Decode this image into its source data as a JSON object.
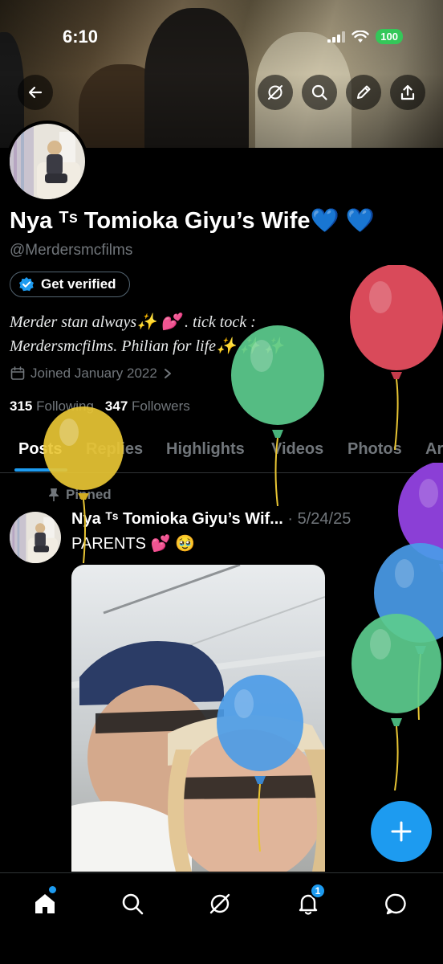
{
  "status_bar": {
    "time": "6:10",
    "battery": "100"
  },
  "header": {
    "back_icon": "arrow-left-icon",
    "grok_icon": "grok-icon",
    "search_icon": "search-icon",
    "edit_icon": "pencil-icon",
    "share_icon": "share-icon"
  },
  "profile": {
    "display_name": "Nya ᵀˢ Tomioka Giyu’s Wife💙 💙",
    "handle": "@Merdersmcfilms",
    "verify_label": "Get verified",
    "bio_line1": "Merder stan always✨ 💕 .   tick tock :",
    "bio_line2": "Merdersmcfilms.   Philian for life✨ ✨ ✨",
    "joined": "Joined January 2022",
    "following_count": "315",
    "following_label": "Following",
    "followers_count": "347",
    "followers_label": "Followers"
  },
  "tabs": [
    "Posts",
    "Replies",
    "Highlights",
    "Videos",
    "Photos",
    "Ar"
  ],
  "post": {
    "pinned_label": "Pinned",
    "author": "Nya ᵀˢ Tomioka Giyu’s Wif...",
    "date": "· 5/24/25",
    "text": "PARENTS 💕 🥹"
  },
  "nav": {
    "notifications_badge": "1"
  },
  "colors": {
    "accent": "#1d9bf0",
    "background": "#000000",
    "muted_text": "#71767b",
    "balloon_red": "#d94a5a",
    "balloon_green": "#5ccc8e",
    "balloon_yellow": "#e8c534",
    "balloon_purple": "#8b3fd6",
    "balloon_blue": "#4a9be8"
  }
}
